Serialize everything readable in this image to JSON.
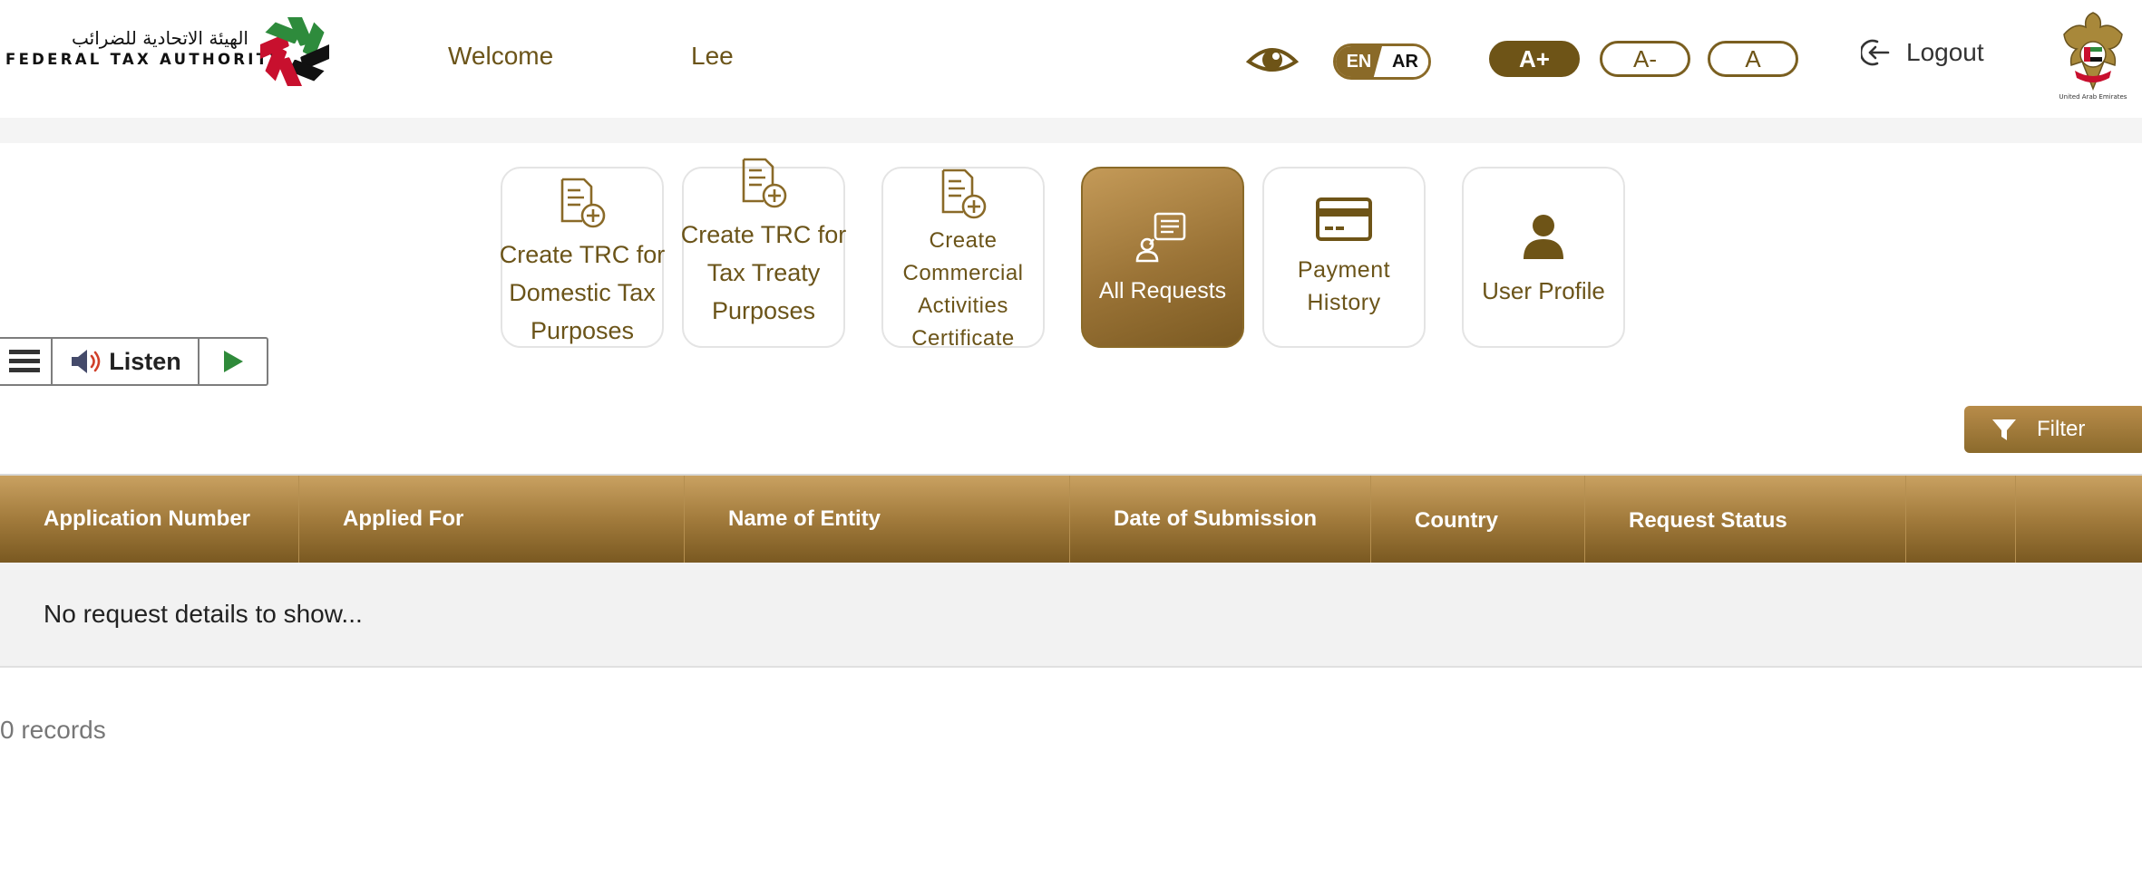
{
  "header": {
    "logo_arabic": "الهيئة الاتحادية للضرائب",
    "logo_english": "FEDERAL TAX AUTHORITY",
    "welcome": "Welcome",
    "username": "Lee",
    "lang_en": "EN",
    "lang_ar": "AR",
    "font_increase": "A+",
    "font_decrease": "A-",
    "font_reset": "A",
    "logout": "Logout",
    "emblem_caption": "United Arab Emirates"
  },
  "tiles": [
    {
      "label": "Create TRC for Domestic Tax Purposes",
      "icon": "document-plus-icon",
      "active": false
    },
    {
      "label": "Create TRC for Tax Treaty Purposes",
      "icon": "document-plus-icon",
      "active": false
    },
    {
      "label": "Create Commercial Activities Certificate",
      "icon": "document-plus-icon",
      "active": false
    },
    {
      "label": "All Requests",
      "icon": "user-list-icon",
      "active": true
    },
    {
      "label": "Payment History",
      "icon": "credit-card-icon",
      "active": false
    },
    {
      "label": "User Profile",
      "icon": "user-icon",
      "active": false
    }
  ],
  "listen": {
    "label": "Listen"
  },
  "filter": {
    "label": "Filter"
  },
  "table": {
    "columns": [
      "Application Number",
      "Applied For",
      "Name of Entity",
      "Date of Submission",
      "Country",
      "Request Status",
      "",
      ""
    ],
    "empty_message": "No request details to show..."
  },
  "records": "0 records",
  "colors": {
    "gold": "#8a6a28",
    "gold_text": "#6b5419",
    "header_gradient_top": "#c9a161",
    "header_gradient_bottom": "#7a5921"
  }
}
